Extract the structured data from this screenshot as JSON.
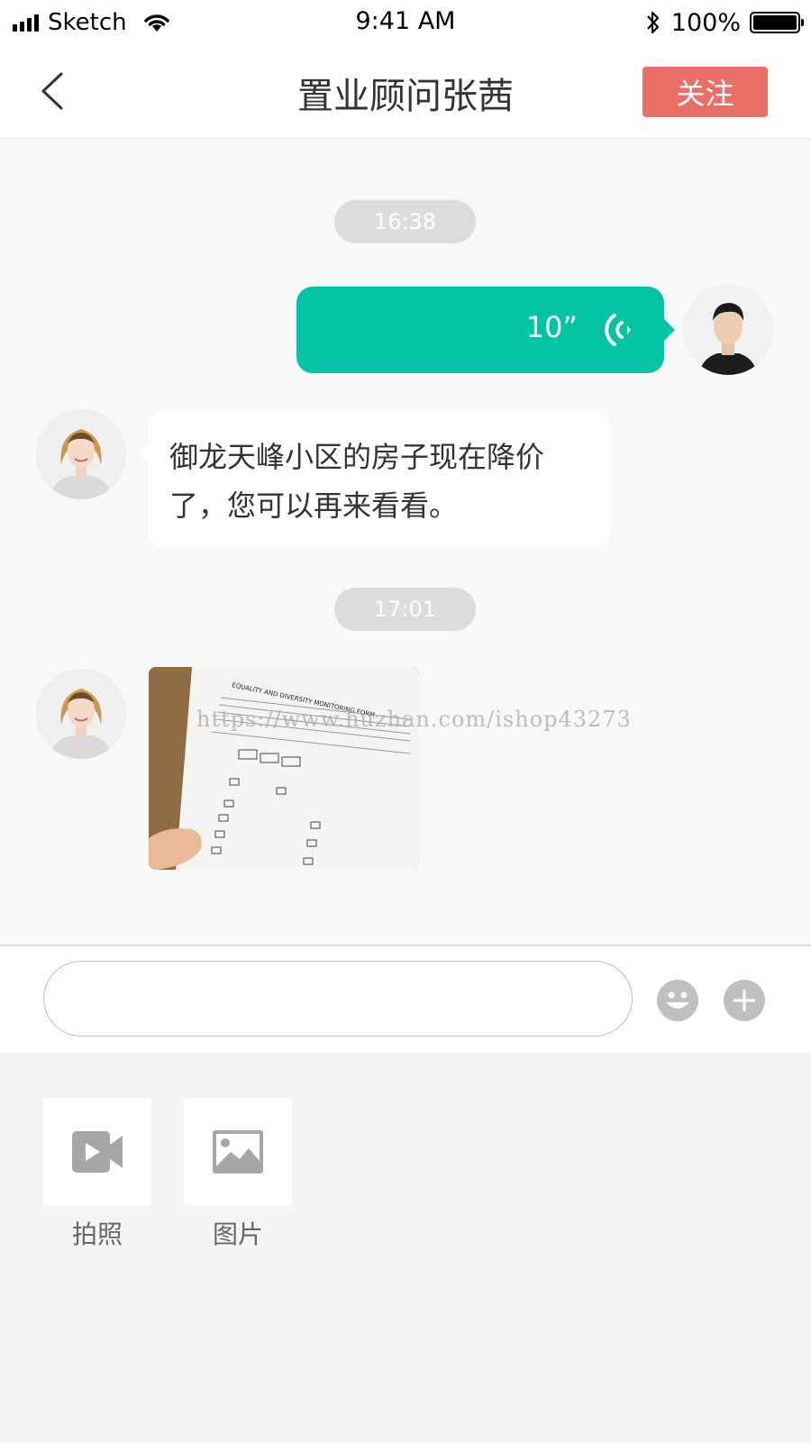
{
  "status_bar": {
    "carrier": "Sketch",
    "time": "9:41 AM",
    "battery_pct": "100%"
  },
  "header": {
    "title": "置业顾问张茜",
    "follow_label": "关注"
  },
  "chat": {
    "messages": [
      {
        "type": "time",
        "text": "16:38"
      },
      {
        "type": "voice",
        "side": "right",
        "duration": "10”"
      },
      {
        "type": "text",
        "side": "left",
        "text": "御龙天峰小区的房子现在降价了，您可以再来看看。"
      },
      {
        "type": "time",
        "text": "17:01"
      },
      {
        "type": "image",
        "side": "left",
        "document_title": "EQUALITY AND DIVERSITY MONITORING FORM"
      }
    ],
    "watermark": "https://www.huzhan.com/ishop43273"
  },
  "input": {
    "value": "",
    "placeholder": ""
  },
  "panel": {
    "actions": [
      {
        "label": "拍照",
        "icon": "video-camera-icon"
      },
      {
        "label": "图片",
        "icon": "image-icon"
      }
    ]
  },
  "colors": {
    "accent": "#00c4a4",
    "follow": "#ea6f67",
    "time_pill": "#dcdcdc"
  }
}
